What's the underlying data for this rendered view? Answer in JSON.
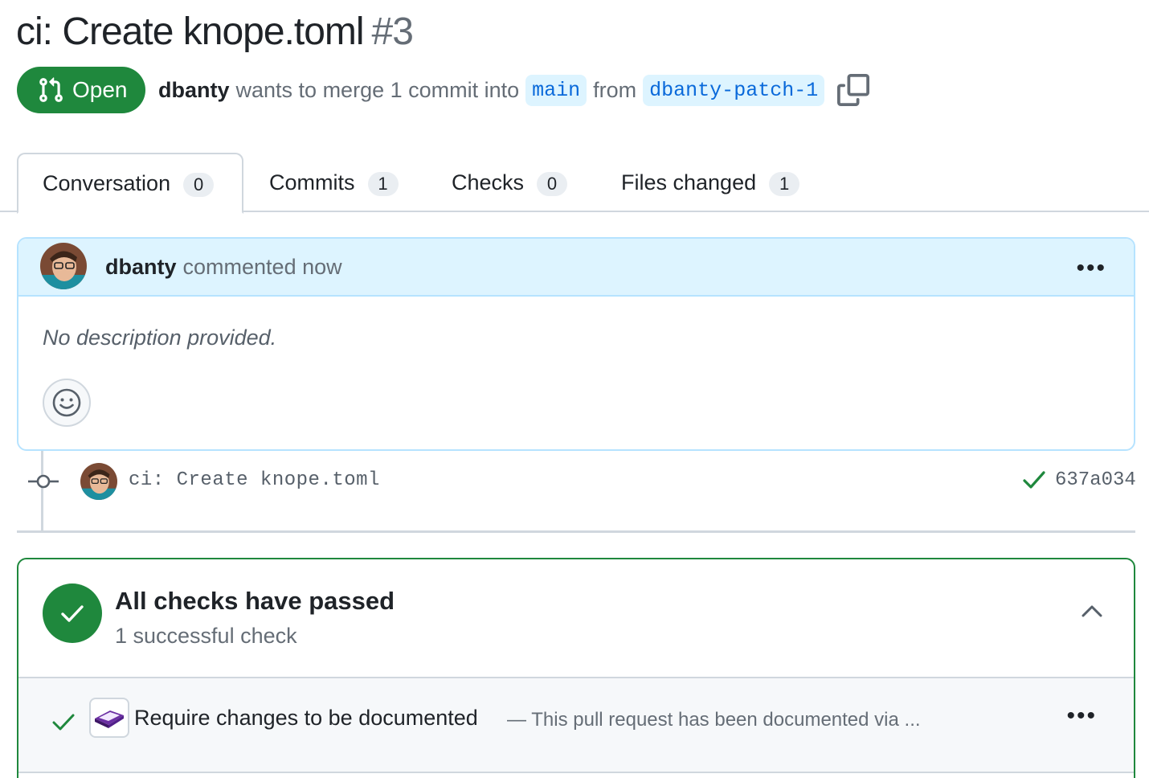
{
  "pr": {
    "title": "ci: Create knope.toml",
    "number": "#3",
    "state_label": "Open",
    "author": "dbanty",
    "merge_text": "wants to merge 1 commit into",
    "base_branch": "main",
    "from_text": "from",
    "head_branch": "dbanty-patch-1"
  },
  "tabs": [
    {
      "label": "Conversation",
      "count": "0"
    },
    {
      "label": "Commits",
      "count": "1"
    },
    {
      "label": "Checks",
      "count": "0"
    },
    {
      "label": "Files changed",
      "count": "1"
    }
  ],
  "comment": {
    "author": "dbanty",
    "action": "commented now",
    "body": "No description provided.",
    "menu_icon": "kebab-horizontal-icon",
    "reaction_icon": "smiley-icon"
  },
  "commit": {
    "message": "ci: Create knope.toml",
    "sha": "637a034",
    "status": "success"
  },
  "checks": {
    "title": "All checks have passed",
    "subtitle": "1 successful check",
    "items": [
      {
        "name": "Require changes to be documented",
        "description": "— This pull request has been documented via ..."
      }
    ]
  },
  "colors": {
    "success": "#1f883d",
    "link": "#0969da",
    "branch_bg": "#ddf4ff",
    "comment_header_bg": "#ddf4ff"
  }
}
